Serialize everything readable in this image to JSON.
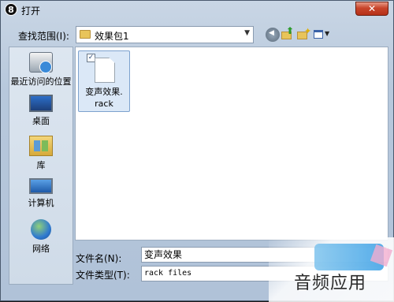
{
  "window": {
    "icon_glyph": "8",
    "title": "打开",
    "close_glyph": "✕"
  },
  "lookin": {
    "label": "查找范围(I):",
    "value": "效果包1"
  },
  "toolbar": {
    "icons": [
      "back-icon",
      "up-folder-icon",
      "new-folder-icon",
      "view-menu-icon"
    ]
  },
  "places": [
    {
      "label": "最近访问的位置",
      "icon": "recent-places-icon"
    },
    {
      "label": "桌面",
      "icon": "desktop-icon"
    },
    {
      "label": "库",
      "icon": "library-icon"
    },
    {
      "label": "计算机",
      "icon": "computer-icon"
    },
    {
      "label": "网络",
      "icon": "network-icon"
    }
  ],
  "files": [
    {
      "name_line1": "变声效果.",
      "name_line2": "rack",
      "checked": true
    }
  ],
  "filename": {
    "label": "文件名(N):",
    "value": "变声效果"
  },
  "filetype": {
    "label": "文件类型(T):",
    "value": "rack files"
  },
  "watermark": {
    "text": "音频应用"
  }
}
